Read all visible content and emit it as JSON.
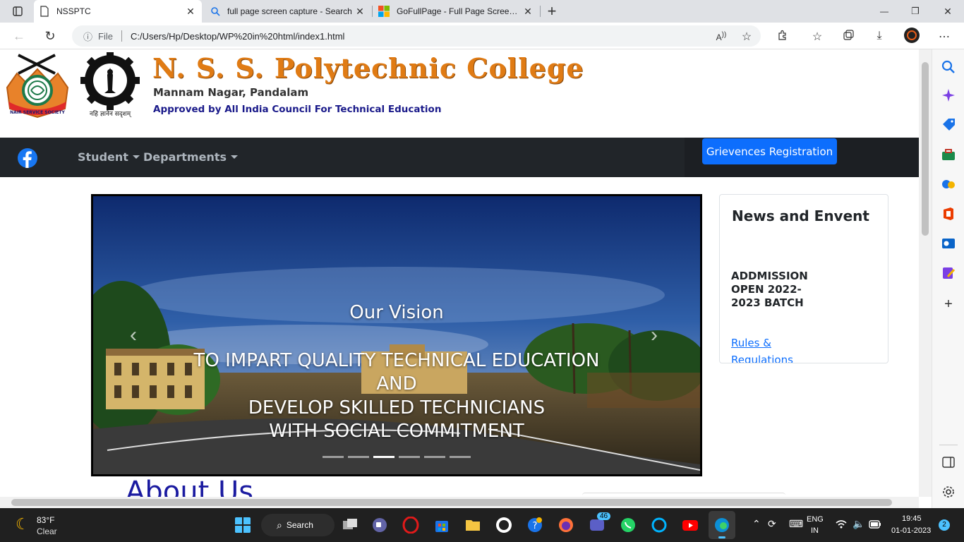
{
  "browser": {
    "tabs": [
      {
        "title": "NSSPTC",
        "close": "✕"
      },
      {
        "title": "full page screen capture - Search",
        "close": "✕"
      },
      {
        "title": "GoFullPage - Full Page Screen Ca",
        "close": "✕"
      }
    ],
    "new_tab": "+",
    "window_controls": {
      "minimize": "—",
      "restore": "❐",
      "close": "✕"
    },
    "address": {
      "info_label": "File",
      "url": "C:/Users/Hp/Desktop/WP%20in%20html/index1.html"
    },
    "nav": {
      "back": "←",
      "reload": "↻"
    }
  },
  "site": {
    "header": {
      "college_name": "N. S. S. Polytechnic College",
      "place": "Mannam Nagar, Pandalam",
      "approval": "Approved by All India Council For Technical Education",
      "logo_left_text": "NAIR SERVICE SOCIETY",
      "logo_right_text": "नहि ज्ञानेन सदृशम्"
    },
    "nav": {
      "items": [
        {
          "label": "Student"
        },
        {
          "label": "Departments"
        }
      ],
      "grievance_button": "Grievences Registration"
    },
    "carousel": {
      "heading": "Our Vision",
      "lines": [
        "TO IMPART QUALITY TECHNICAL EDUCATION",
        "AND",
        "DEVELOP SKILLED TECHNICIANS",
        "WITH SOCIAL COMMITMENT"
      ],
      "active_slide": 3,
      "slide_count": 6,
      "prev": "‹",
      "next": "›"
    },
    "news": {
      "title": "News and Envent",
      "item": "ADDMISSION OPEN 2022-2023 BATCH",
      "link": "Rules & Regulations"
    },
    "about_heading": "About Us"
  },
  "taskbar": {
    "weather": {
      "temp": "83°F",
      "desc": "Clear"
    },
    "search_label": "Search",
    "lang": {
      "line1": "ENG",
      "line2": "IN"
    },
    "clock": {
      "time": "19:45",
      "date": "01-01-2023"
    },
    "notif_count": "2",
    "badge_count": "46"
  }
}
